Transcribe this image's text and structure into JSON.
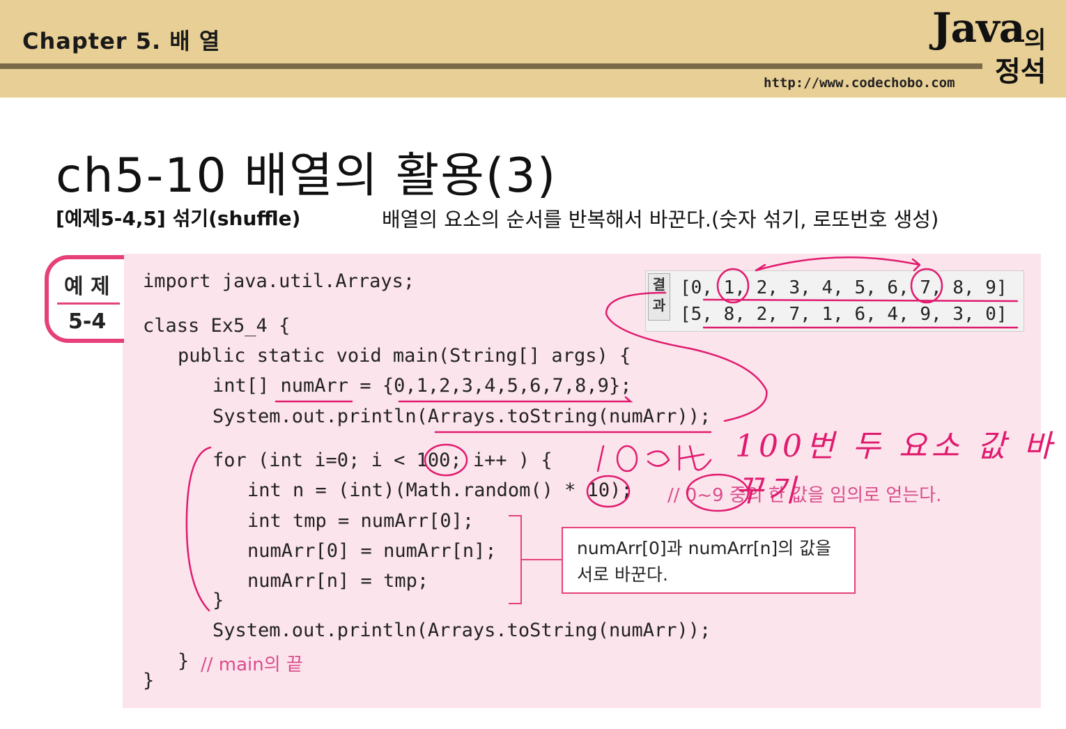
{
  "header": {
    "chapter": "Chapter 5. 배 열",
    "brand_java": "Java",
    "brand_ui": "의",
    "brand_jeongseok": "정석",
    "url": "http://www.codechobo.com"
  },
  "slide": {
    "title": "ch5-10 배열의 활용(3)",
    "example_label": "[예제5-4,5]   섞기(shuffle)",
    "description": "배열의 요소의 순서를 반복해서 바꾼다.(숫자 섞기, 로또번호 생성)"
  },
  "badge": {
    "top": "예 제",
    "bottom": "5-4"
  },
  "code": {
    "lines": [
      "import java.util.Arrays;",
      "class Ex5_4 {",
      "public static void main(String[] args) {",
      "int[] numArr = {0,1,2,3,4,5,6,7,8,9};",
      "System.out.println(Arrays.toString(numArr));",
      "for (int i=0; i < 100; i++ ) {",
      "int n = (int)(Math.random() * 10);",
      "int tmp = numArr[0];",
      "numArr[0] = numArr[n];",
      "numArr[n] = tmp;",
      "}",
      "System.out.println(Arrays.toString(numArr));",
      "}",
      "}"
    ],
    "comment_random": "// 0~9 중의 한 값을 임의로 얻는다.",
    "comment_main_end": "// main의 끝"
  },
  "result": {
    "tag": "결과",
    "line1": "[0, 1, 2, 3, 4, 5, 6, 7, 8, 9]",
    "line2": "[5, 8, 2, 7, 1, 6, 4, 9, 3, 0]"
  },
  "note": {
    "text": "numArr[0]과 numArr[n]의 값을 서로 바꾼다."
  },
  "annotation": {
    "handwritten": "100번 두 요소 값 바꾸기"
  },
  "colors": {
    "header_band": "#e8cf95",
    "accent_pink": "#e6407a",
    "code_bg": "#fce4ec",
    "ink": "#e01a6e"
  }
}
